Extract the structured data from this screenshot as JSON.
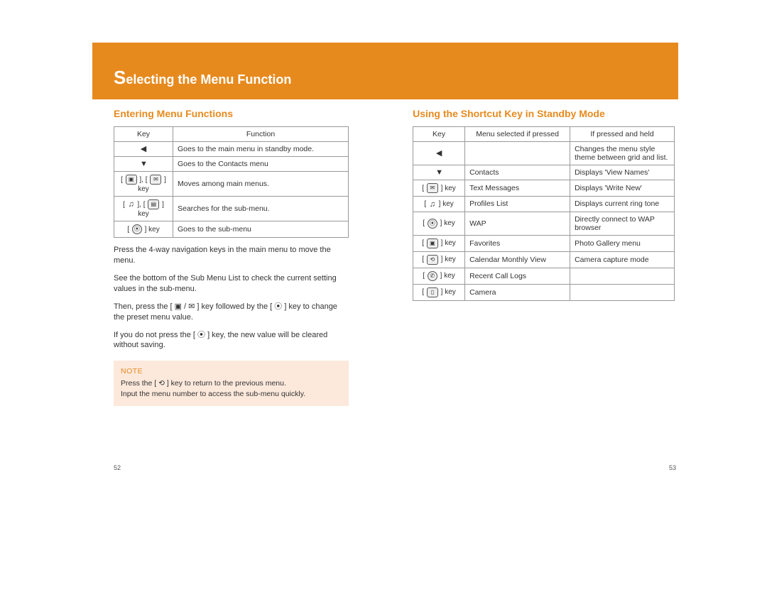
{
  "header": {
    "title_prefix": "S",
    "title_rest": "electing the Menu Function"
  },
  "left": {
    "heading": "Entering Menu Functions",
    "table": {
      "cols": [
        "Key",
        "Function"
      ],
      "rows": [
        {
          "key_icons": [
            "nav-left"
          ],
          "key_label": "",
          "func": "Goes to the main menu in standby mode."
        },
        {
          "key_icons": [
            "nav-down"
          ],
          "key_label": "",
          "func": "Goes to the Contacts menu"
        },
        {
          "key_icons": [
            "cam",
            "mail"
          ],
          "key_label": "[      ], [      ] key",
          "func": "Moves among main menus."
        },
        {
          "key_icons": [
            "music",
            "book"
          ],
          "key_label": "[      ], [      ] key",
          "func": "Searches for the sub-menu."
        },
        {
          "key_icons": [
            "ok"
          ],
          "key_label": "[      ] key",
          "func": "Goes to the sub-menu"
        }
      ]
    },
    "paras": [
      "Press the 4-way navigation keys in the main menu to move the menu.",
      "See the bottom of the Sub Menu List to check the current setting values in the sub-menu.",
      "Then, press the [ ▣ / ✉ ] key followed by the [ ⦿ ] key to change the preset menu value.",
      "If you do not press the [ ⦿ ] key, the new value will be cleared without saving."
    ],
    "note": {
      "label": "NOTE",
      "lines": [
        "Press the [ ⟲ ] key to return to the previous menu.",
        "Input the menu number to access the sub-menu quickly."
      ]
    },
    "pagenum": "52"
  },
  "right": {
    "heading": "Using the Shortcut Key in Standby Mode",
    "table": {
      "cols": [
        "Key",
        "Menu selected if pressed",
        "If pressed and held"
      ],
      "rows": [
        {
          "key_icons": [
            "nav-left"
          ],
          "key_label": "",
          "pressed": "",
          "held": "Changes the menu style theme between grid and list."
        },
        {
          "key_icons": [
            "nav-down"
          ],
          "key_label": "",
          "pressed": "Contacts",
          "held": "Displays 'View Names'"
        },
        {
          "key_icons": [
            "mail"
          ],
          "key_label": "[      ] key",
          "pressed": "Text Messages",
          "held": "Displays 'Write New'"
        },
        {
          "key_icons": [
            "music"
          ],
          "key_label": "[      ] key",
          "pressed": "Profiles List",
          "held": "Displays current ring tone"
        },
        {
          "key_icons": [
            "ok"
          ],
          "key_label": "[      ] key",
          "pressed": "WAP",
          "held": "Directly connect to WAP browser"
        },
        {
          "key_icons": [
            "cam"
          ],
          "key_label": "[      ] key",
          "pressed": "Favorites",
          "held": "Photo Gallery menu"
        },
        {
          "key_icons": [
            "left-long"
          ],
          "key_label": "[      ] key",
          "pressed": "Calendar Monthly View",
          "held": "Camera capture mode"
        },
        {
          "key_icons": [
            "phone"
          ],
          "key_label": "[      ] key",
          "pressed": "Recent Call Logs",
          "held": ""
        },
        {
          "key_icons": [
            "side"
          ],
          "key_label": "[      ] key",
          "pressed": "Camera",
          "held": ""
        }
      ]
    },
    "pagenum": "53"
  },
  "icon_glyphs": {
    "nav-left": "◀",
    "nav-down": "▼",
    "cam": "▣",
    "mail": "✉",
    "music": "♫",
    "book": "▤",
    "ok": "⦿",
    "left-long": "⟲",
    "phone": "✆",
    "side": "▯"
  }
}
